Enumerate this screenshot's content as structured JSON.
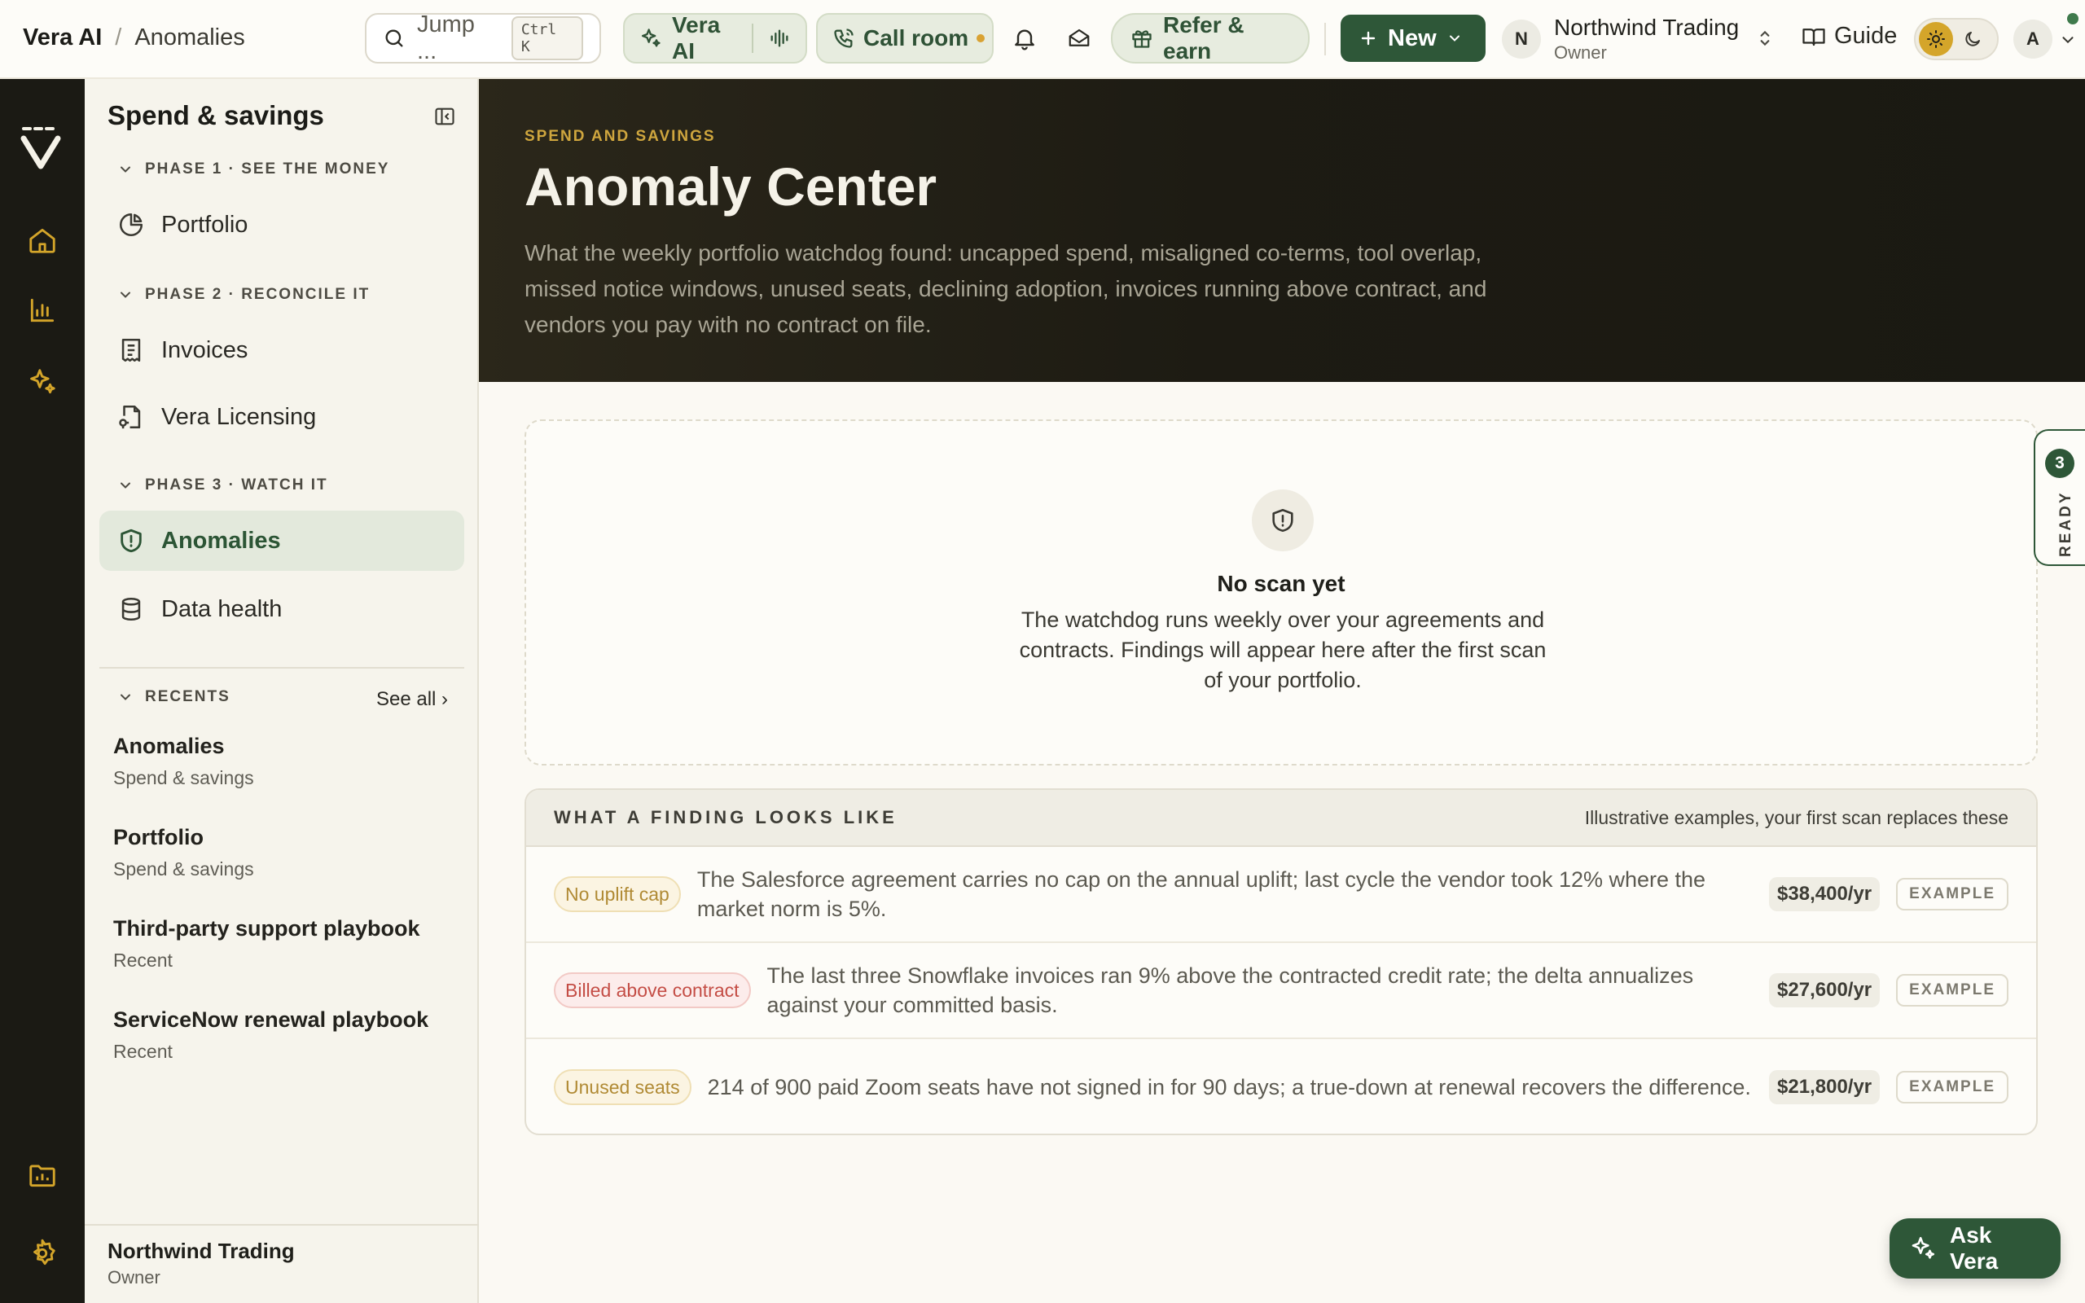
{
  "breadcrumb": {
    "app": "Vera AI",
    "separator": "/",
    "page": "Anomalies"
  },
  "topbar": {
    "search_label": "Jump ...",
    "search_shortcut": "Ctrl K",
    "vera_ai_label": "Vera AI",
    "call_room_label": "Call room",
    "refer_label": "Refer & earn",
    "new_label": "New",
    "org_initial": "N",
    "org_name": "Northwind Trading",
    "org_role": "Owner",
    "guide_label": "Guide",
    "user_initial": "A"
  },
  "sidebar": {
    "title": "Spend & savings",
    "phases": [
      {
        "label": "PHASE 1 · SEE THE MONEY",
        "items": [
          {
            "label": "Portfolio",
            "icon": "pie-chart-icon"
          }
        ]
      },
      {
        "label": "PHASE 2 · RECONCILE IT",
        "items": [
          {
            "label": "Invoices",
            "icon": "receipt-icon"
          },
          {
            "label": "Vera Licensing",
            "icon": "document-key-icon"
          }
        ]
      },
      {
        "label": "PHASE 3 · WATCH IT",
        "items": [
          {
            "label": "Anomalies",
            "icon": "shield-alert-icon",
            "active": true
          },
          {
            "label": "Data health",
            "icon": "database-icon"
          }
        ]
      }
    ],
    "recents_label": "RECENTS",
    "see_all": "See all ›",
    "recents": [
      {
        "title": "Anomalies",
        "subtitle": "Spend & savings"
      },
      {
        "title": "Portfolio",
        "subtitle": "Spend & savings"
      },
      {
        "title": "Third-party support playbook",
        "subtitle": "Recent"
      },
      {
        "title": "ServiceNow renewal playbook",
        "subtitle": "Recent"
      }
    ],
    "footer": {
      "name": "Northwind Trading",
      "role": "Owner"
    }
  },
  "hero": {
    "eyebrow": "SPEND AND SAVINGS",
    "title": "Anomaly Center",
    "description": "What the weekly portfolio watchdog found: uncapped spend, misaligned co-terms, tool overlap, missed notice windows, unused seats, declining adoption, invoices running above contract, and vendors you pay with no contract on file."
  },
  "empty_state": {
    "title": "No scan yet",
    "description": "The watchdog runs weekly over your agreements and contracts. Findings will appear here after the first scan of your portfolio."
  },
  "findings": {
    "title": "WHAT A FINDING LOOKS LIKE",
    "subtitle": "Illustrative examples, your first scan replaces these",
    "rows": [
      {
        "tag": "No uplift cap",
        "tag_color": "#b8923c",
        "text": "The Salesforce agreement carries no cap on the annual uplift; last cycle the vendor took 12% where the market norm is 5%.",
        "amount": "$38,400/yr",
        "badge": "EXAMPLE"
      },
      {
        "tag": "Billed above contract",
        "tag_color": "#c9544c",
        "text": "The last three Snowflake invoices ran 9% above the contracted credit rate; the delta annualizes against your committed basis.",
        "amount": "$27,600/yr",
        "badge": "EXAMPLE"
      },
      {
        "tag": "Unused seats",
        "tag_color": "#b8923c",
        "text": "214 of 900 paid Zoom seats have not signed in for 90 days; a true-down at renewal recovers the difference.",
        "amount": "$21,800/yr",
        "badge": "EXAMPLE"
      }
    ]
  },
  "ready_tab": {
    "count": "3",
    "label": "READY"
  },
  "ask_button": {
    "label": "Ask Vera"
  },
  "colors": {
    "accent_green": "#2e5738",
    "accent_gold": "#cfa63e",
    "rail": "#1b1a14"
  }
}
